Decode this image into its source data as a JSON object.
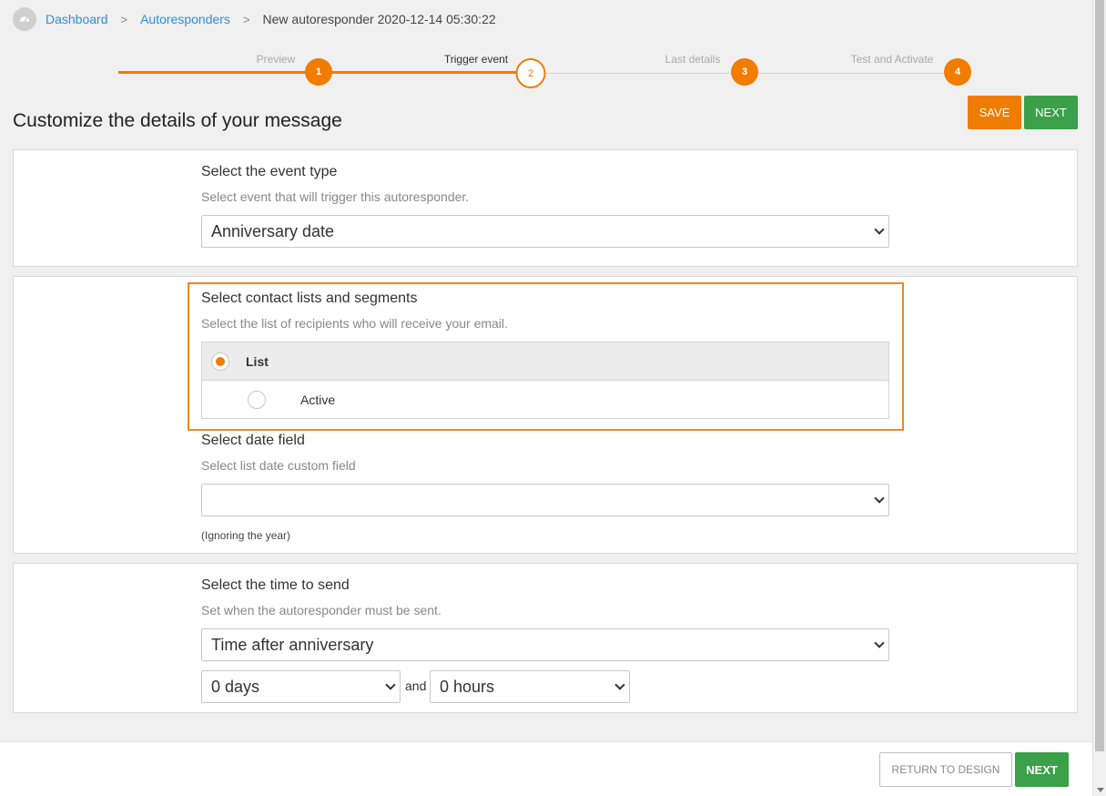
{
  "breadcrumb": {
    "home_icon": "dashboard-gauge-icon",
    "items": [
      "Dashboard",
      "Autoresponders"
    ],
    "current": "New autoresponder 2020-12-14 05:30:22",
    "separator": ">"
  },
  "stepper": {
    "steps": [
      {
        "label": "Preview",
        "number": "1"
      },
      {
        "label": "Trigger event",
        "number": "2"
      },
      {
        "label": "Last details",
        "number": "3"
      },
      {
        "label": "Test and Activate",
        "number": "4"
      }
    ],
    "current_step": 2
  },
  "page_title": "Customize the details of your message",
  "buttons": {
    "save": "SAVE",
    "next": "NEXT",
    "return_to_design": "RETURN TO DESIGN"
  },
  "event_section": {
    "title": "Select the event type",
    "description": "Select event that will trigger this autoresponder.",
    "selected": "Anniversary date"
  },
  "contacts_section": {
    "title": "Select contact lists and segments",
    "description": "Select the list of recipients who will receive your email.",
    "header_label": "List",
    "rows": [
      {
        "label": "Active",
        "checked": false
      }
    ]
  },
  "date_section": {
    "title": "Select date field",
    "description": "Select list date custom field",
    "selected": "",
    "note": "(Ignoring the year)"
  },
  "time_section": {
    "title": "Select the time to send",
    "description": "Set when the autoresponder must be sent.",
    "selected": "Time after anniversary",
    "days": "0 days",
    "and_label": "and",
    "hours": "0 hours"
  },
  "colors": {
    "accent": "#f07c00",
    "success": "#3aa04a",
    "link": "#2f8fd6"
  }
}
